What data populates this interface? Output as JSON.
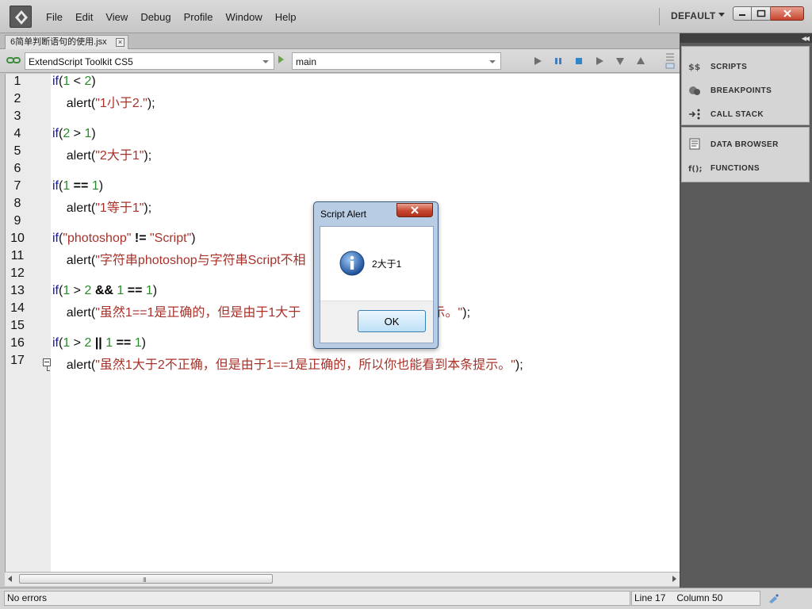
{
  "menubar": {
    "items": [
      "File",
      "Edit",
      "View",
      "Debug",
      "Profile",
      "Window",
      "Help"
    ],
    "workspace": "DEFAULT"
  },
  "tab": {
    "label": "6简单判断语句的使用.jsx"
  },
  "toolbar": {
    "target": "ExtendScript Toolkit CS5",
    "engine": "main"
  },
  "editor": {
    "line_numbers": [
      "1",
      "2",
      "3",
      "4",
      "5",
      "6",
      "7",
      "8",
      "9",
      "10",
      "11",
      "12",
      "13",
      "14",
      "15",
      "16",
      "17"
    ]
  },
  "right_panel": {
    "items": [
      "SCRIPTS",
      "BREAKPOINTS",
      "CALL STACK",
      "DATA BROWSER",
      "FUNCTIONS"
    ]
  },
  "status": {
    "message": "No errors",
    "line": "Line 17",
    "column": "Column 50"
  },
  "dialog": {
    "title": "Script Alert",
    "message": "2大于1",
    "ok_label": "OK"
  },
  "colors": {
    "keyword": "#1010c8",
    "number": "#2a8a2a",
    "string": "#a8322a"
  }
}
